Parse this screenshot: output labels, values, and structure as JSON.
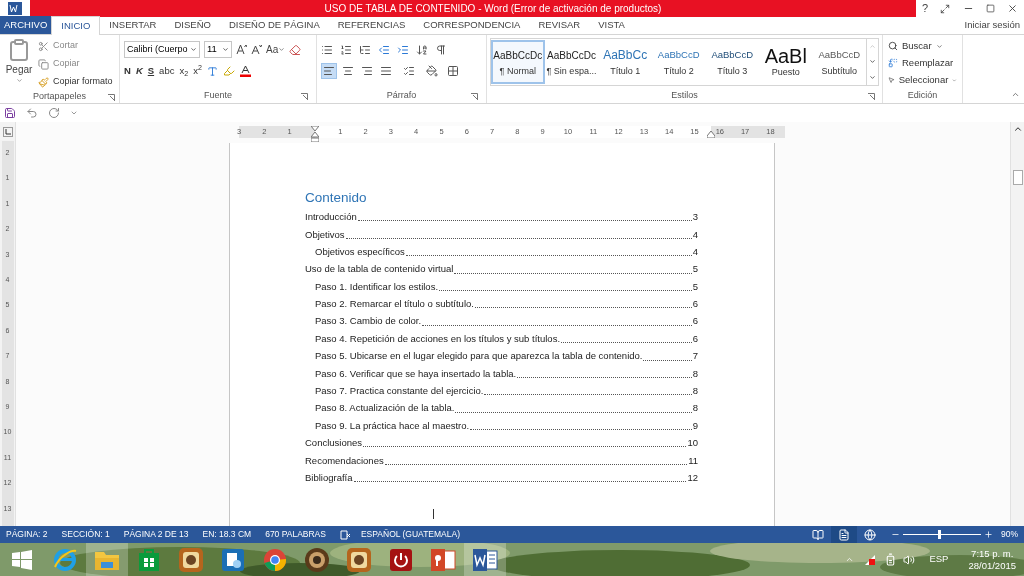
{
  "title_bar": {
    "title": "USO DE TABLA DE CONTENIDO -  Word (Error de activación de productos)",
    "help": "?"
  },
  "file_tab": "ARCHIVO",
  "tabs": [
    {
      "label": "INICIO",
      "selected": true
    },
    {
      "label": "INSERTAR",
      "selected": false
    },
    {
      "label": "DISEÑO",
      "selected": false
    },
    {
      "label": "DISEÑO DE PÁGINA",
      "selected": false
    },
    {
      "label": "REFERENCIAS",
      "selected": false
    },
    {
      "label": "CORRESPONDENCIA",
      "selected": false
    },
    {
      "label": "REVISAR",
      "selected": false
    },
    {
      "label": "VISTA",
      "selected": false
    }
  ],
  "sign_in": "Iniciar sesión",
  "clipboard": {
    "paste": "Pegar",
    "cut": "Cortar",
    "copy": "Copiar",
    "format_painter": "Copiar formato",
    "label": "Portapapeles"
  },
  "font": {
    "name": "Calibri (Cuerpo",
    "size": "11",
    "case": "Aa",
    "styles": [
      "N",
      "K",
      "S",
      "abc",
      "x$_{2}$",
      "x$^{2}$"
    ],
    "label": "Fuente"
  },
  "paragraph": {
    "alignment": [
      {
        "selected": true
      },
      {
        "selected": false
      },
      {
        "selected": false
      },
      {
        "selected": false
      }
    ],
    "label": "Párrafo"
  },
  "styles": {
    "items": [
      {
        "preview": "AaBbCcDc",
        "name": "¶ Normal",
        "kind": "normal",
        "selected": true
      },
      {
        "preview": "AaBbCcDc",
        "name": "¶ Sin espa...",
        "kind": "normal",
        "selected": false
      },
      {
        "preview": "AaBbCc",
        "name": "Título 1",
        "kind": "heading1",
        "selected": false
      },
      {
        "preview": "AaBbCcD",
        "name": "Título 2",
        "kind": "heading2",
        "selected": false
      },
      {
        "preview": "AaBbCcD",
        "name": "Título 3",
        "kind": "heading3",
        "selected": false
      },
      {
        "preview": "AaBl",
        "name": "Puesto",
        "kind": "title",
        "selected": false
      },
      {
        "preview": "AaBbCcD",
        "name": "Subtítulo",
        "kind": "subtitle",
        "selected": false
      }
    ],
    "label": "Estilos"
  },
  "editing": {
    "find": "Buscar",
    "replace": "Reemplazar",
    "select": "Seleccionar",
    "label": "Edición"
  },
  "ruler": [
    "3",
    "2",
    "1",
    "1",
    "2",
    "3",
    "4",
    "5",
    "6",
    "7",
    "8",
    "9",
    "10",
    "11",
    "12",
    "13",
    "14",
    "15",
    "16",
    "17",
    "18"
  ],
  "vertical_ruler": [
    "2",
    "1",
    "1",
    "2",
    "3",
    "4",
    "5",
    "6",
    "7",
    "8",
    "9",
    "10",
    "11",
    "12",
    "13"
  ],
  "document": {
    "heading": "Contenido",
    "entries": [
      {
        "title": "Introducción",
        "page": "3"
      },
      {
        "title": "Objetivos",
        "page": "4",
        "children": [
          {
            "title": "Objetivos específicos",
            "page": "4"
          }
        ]
      },
      {
        "title": "Uso de la tabla de contenido virtual",
        "page": "5",
        "children": [
          {
            "title": "Paso 1. Identificar los estilos.",
            "page": "5"
          },
          {
            "title": "Paso 2. Remarcar el título o subtítulo.",
            "page": "6"
          },
          {
            "title": "Paso 3. Cambio de color.",
            "page": "6"
          },
          {
            "title": "Paso 4. Repetición de acciones en los títulos y sub títulos.",
            "page": "6"
          },
          {
            "title": "Paso 5. Ubicarse en el lugar elegido para que aparezca la tabla de contenido.",
            "page": "7"
          },
          {
            "title": "Paso 6. Verificar que se haya insertado la tabla.",
            "page": "8"
          },
          {
            "title": "Paso 7. Practica constante del ejercicio.",
            "page": "8"
          },
          {
            "title": "Paso 8. Actualización de la tabla.",
            "page": "8"
          },
          {
            "title": "Paso 9. La práctica hace al maestro.",
            "page": "9"
          }
        ]
      },
      {
        "title": "Conclusiones",
        "page": "10"
      },
      {
        "title": "Recomendaciones",
        "page": "11"
      },
      {
        "title": "Bibliografía",
        "page": "12"
      }
    ]
  },
  "status_bar": {
    "items": [
      "PÁGINA: 2",
      "SECCIÓN: 1",
      "PÁGINA 2 DE 13",
      "EN: 18.3 CM",
      "670 PALABRAS"
    ],
    "language": "ESPAÑOL (GUATEMALA)",
    "views": [
      {
        "kind": "read",
        "selected": false
      },
      {
        "kind": "print",
        "selected": true
      },
      {
        "kind": "web",
        "selected": false
      }
    ],
    "zoom": {
      "level": 0.45,
      "reading": "90%"
    }
  },
  "taskbar": {
    "apps": [
      {
        "kind": "ie",
        "active": false
      },
      {
        "kind": "folder",
        "active": true
      },
      {
        "kind": "store",
        "active": false
      },
      {
        "kind": "app",
        "active": false
      },
      {
        "kind": "settings",
        "active": false
      },
      {
        "kind": "chrome",
        "active": false
      },
      {
        "kind": "speaker",
        "active": false
      },
      {
        "kind": "app",
        "active": false
      },
      {
        "kind": "power",
        "active": false
      },
      {
        "kind": "powerpoint",
        "active": false
      },
      {
        "kind": "word",
        "active": true
      }
    ],
    "language": "ESP",
    "time": "7:15 p. m.",
    "date": "28/01/2015"
  }
}
